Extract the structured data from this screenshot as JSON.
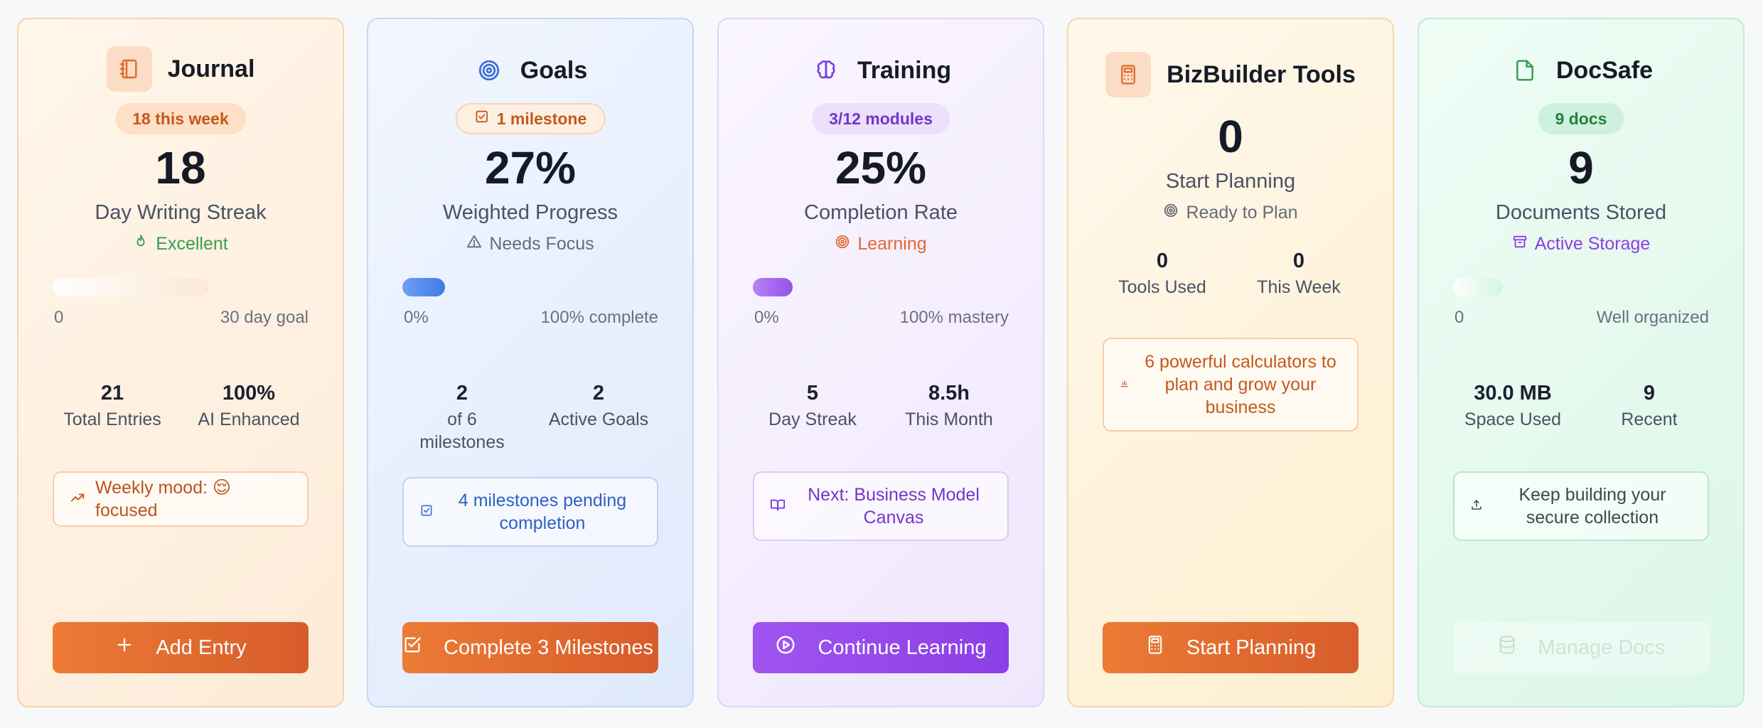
{
  "cards": [
    {
      "title": "Journal",
      "icon": "notebook-icon",
      "badge": "18 this week",
      "big": "18",
      "label": "Day Writing Streak",
      "status": "Excellent",
      "status_icon": "flame-icon",
      "progress": 0,
      "range_left": "0",
      "range_right": "30 day goal",
      "stats": [
        {
          "value": "21",
          "label": "Total Entries"
        },
        {
          "value": "100%",
          "label": "AI Enhanced"
        }
      ],
      "note": "Weekly mood: 😌 focused",
      "note_icon": "trending-up-icon",
      "button": "Add Entry",
      "button_icon": "plus-icon"
    },
    {
      "title": "Goals",
      "icon": "target-icon",
      "badge": "1 milestone",
      "badge_icon": "checkbox-icon",
      "big": "27%",
      "label": "Weighted Progress",
      "status": "Needs Focus",
      "status_icon": "warning-icon",
      "progress": 0.27,
      "range_left": "0%",
      "range_right": "100% complete",
      "stats": [
        {
          "value": "2",
          "label": "of 6 milestones"
        },
        {
          "value": "2",
          "label": "Active Goals"
        }
      ],
      "note": "4 milestones pending completion",
      "note_icon": "checkbox-icon",
      "button": "Complete 3 Milestones",
      "button_icon": "checkbox-icon"
    },
    {
      "title": "Training",
      "icon": "brain-icon",
      "badge": "3/12 modules",
      "big": "25%",
      "label": "Completion Rate",
      "status": "Learning",
      "status_icon": "target-icon",
      "progress": 0.25,
      "range_left": "0%",
      "range_right": "100% mastery",
      "stats": [
        {
          "value": "5",
          "label": "Day Streak"
        },
        {
          "value": "8.5h",
          "label": "This Month"
        }
      ],
      "note": "Next: Business Model Canvas",
      "note_icon": "book-icon",
      "button": "Continue Learning",
      "button_icon": "play-circle-icon"
    },
    {
      "title": "BizBuilder Tools",
      "icon": "calculator-icon",
      "big": "0",
      "label": "Start Planning",
      "status": "Ready to Plan",
      "status_icon": "target-icon",
      "stats": [
        {
          "value": "0",
          "label": "Tools Used"
        },
        {
          "value": "0",
          "label": "This Week"
        }
      ],
      "note": "6 powerful calculators to plan and grow your business",
      "note_icon": "bar-chart-icon",
      "button": "Start Planning",
      "button_icon": "calculator-icon"
    },
    {
      "title": "DocSafe",
      "icon": "file-icon",
      "badge": "9 docs",
      "big": "9",
      "label": "Documents Stored",
      "status": "Active Storage",
      "status_icon": "archive-icon",
      "progress": 0,
      "range_left": "0",
      "range_right": "Well organized",
      "stats": [
        {
          "value": "30.0 MB",
          "label": "Space Used"
        },
        {
          "value": "9",
          "label": "Recent"
        }
      ],
      "note": "Keep building your secure collection",
      "note_icon": "upload-icon",
      "button": "Manage Docs",
      "button_icon": "database-icon"
    }
  ],
  "colors": {
    "orange_accent": "#e0692f",
    "blue_accent": "#3f6fd6",
    "purple_accent": "#7b3fd8",
    "green_accent": "#2e9a4b"
  }
}
